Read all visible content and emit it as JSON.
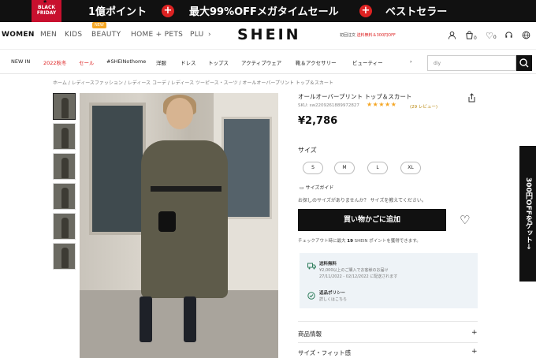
{
  "promo_bar": {
    "badge": "BLACK FRIDAY",
    "items": [
      "1億ポイント",
      "最大99%OFFメガタイムセール",
      "ベストセラー"
    ]
  },
  "header": {
    "categories": [
      "WOMEN",
      "MEN",
      "KIDS",
      "BEAUTY",
      "HOME + PETS",
      "PLU"
    ],
    "new_tag": "NEW",
    "logo": "SHEIN",
    "promo_text": "初回注文",
    "promo_text_red": "送料無料＆300円OFF",
    "cart_count": "0",
    "wish_count": "0"
  },
  "subnav": {
    "items": [
      "NEW IN",
      "2022秋冬",
      "セール",
      "#SHEINothome",
      "洋服",
      "ドレス",
      "トップス",
      "アクティブウェア",
      "靴＆アクセサリー",
      "ビューティー"
    ],
    "search_value": "diy"
  },
  "breadcrumb": "ホーム / レディースファッション / レディース コーデ / レディース ツーピース・スーツ / オールオーバープリント トップ＆スカート",
  "product": {
    "title": "オールオーバープリント トップ＆スカート",
    "sku": "SKU: sw2209261889972827",
    "stars": "★★★★★",
    "reviews": "(29 レビュー)",
    "price": "¥2,786",
    "size_label": "サイズ",
    "sizes": [
      "S",
      "M",
      "L",
      "XL"
    ],
    "size_guide": "サイズガイド",
    "fit_question": "お探しのサイズがありませんか？ サイズを教えてください。",
    "add_to_cart": "買い物かごに追加",
    "points_pre": "チェックアウト時に最大",
    "points_n": "19",
    "points_post": "SHEIN ポイントを獲得できます。",
    "shipping_title": "送料無料",
    "shipping_detail_1": "¥2,000以上のご購入でお客様のお届け",
    "shipping_detail_2": "27/11/2022 - 02/12/2022 に配送されます",
    "return_title": "返品ポリシー",
    "return_detail": "詳しくはこちら",
    "accordion": [
      "商品情報",
      "サイズ・フィット感"
    ]
  },
  "side_tab": "300円OFFをゲット→"
}
